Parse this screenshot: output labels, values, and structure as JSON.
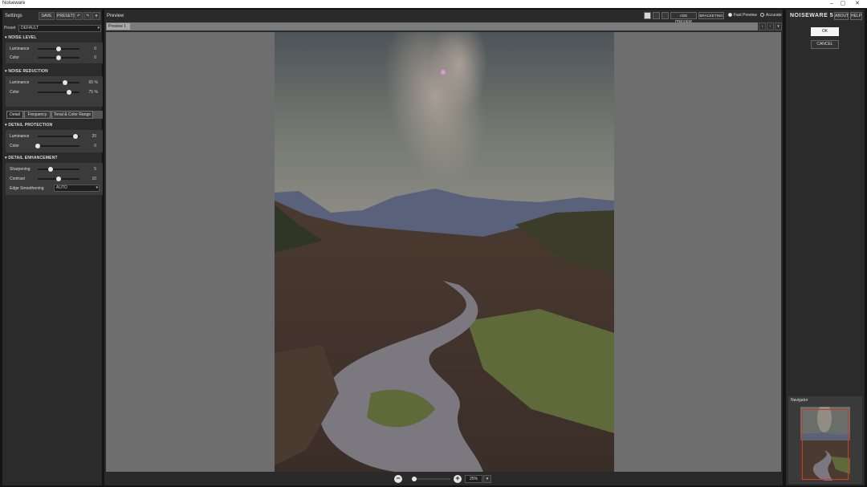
{
  "window": {
    "title": "Noiseware"
  },
  "settings": {
    "title": "Settings",
    "save_label": "SAVE",
    "presets_label": "PRESETS",
    "preset_label": "Preset",
    "preset_value": "DEFAULT",
    "noise_level": {
      "title": "NOISE LEVEL",
      "rows": [
        {
          "label": "Luminance",
          "value": "0",
          "level": 0.5
        },
        {
          "label": "Color",
          "value": "0",
          "level": 0.5
        }
      ]
    },
    "noise_reduction": {
      "title": "NOISE REDUCTION",
      "rows": [
        {
          "label": "Luminance",
          "value": "65",
          "unit": "%",
          "level": 0.65
        },
        {
          "label": "Color",
          "value": "75",
          "unit": "%",
          "level": 0.75
        }
      ]
    },
    "tabs": [
      "Detail",
      "Frequency",
      "Tonal & Color Range"
    ],
    "detail_protection": {
      "title": "DETAIL PROTECTION",
      "rows": [
        {
          "label": "Luminance",
          "value": "20",
          "level": 0.9
        },
        {
          "label": "Color",
          "value": "0",
          "level": 0.0
        }
      ]
    },
    "detail_enhancement": {
      "title": "DETAIL ENHANCEMENT",
      "rows": [
        {
          "label": "Sharpening",
          "value": "5",
          "level": 0.3
        },
        {
          "label": "Contrast",
          "value": "10",
          "level": 0.5
        }
      ],
      "edge_label": "Edge Smoothening",
      "edge_value": "AUTO"
    }
  },
  "preview": {
    "title": "Preview",
    "add_preview_label": "ADD PREVIEW",
    "bracketing_label": "BRACKETING",
    "fast_preview_label": "Fast Preview",
    "accurate_label": "Accurate",
    "tab_label": "Preview 1",
    "zoom_value": "25%"
  },
  "right": {
    "brand": "NOISEWARE 5",
    "about_label": "ABOUT",
    "help_label": "HELP",
    "ok_label": "OK",
    "cancel_label": "CANCEL",
    "navigator_label": "Navigator"
  }
}
